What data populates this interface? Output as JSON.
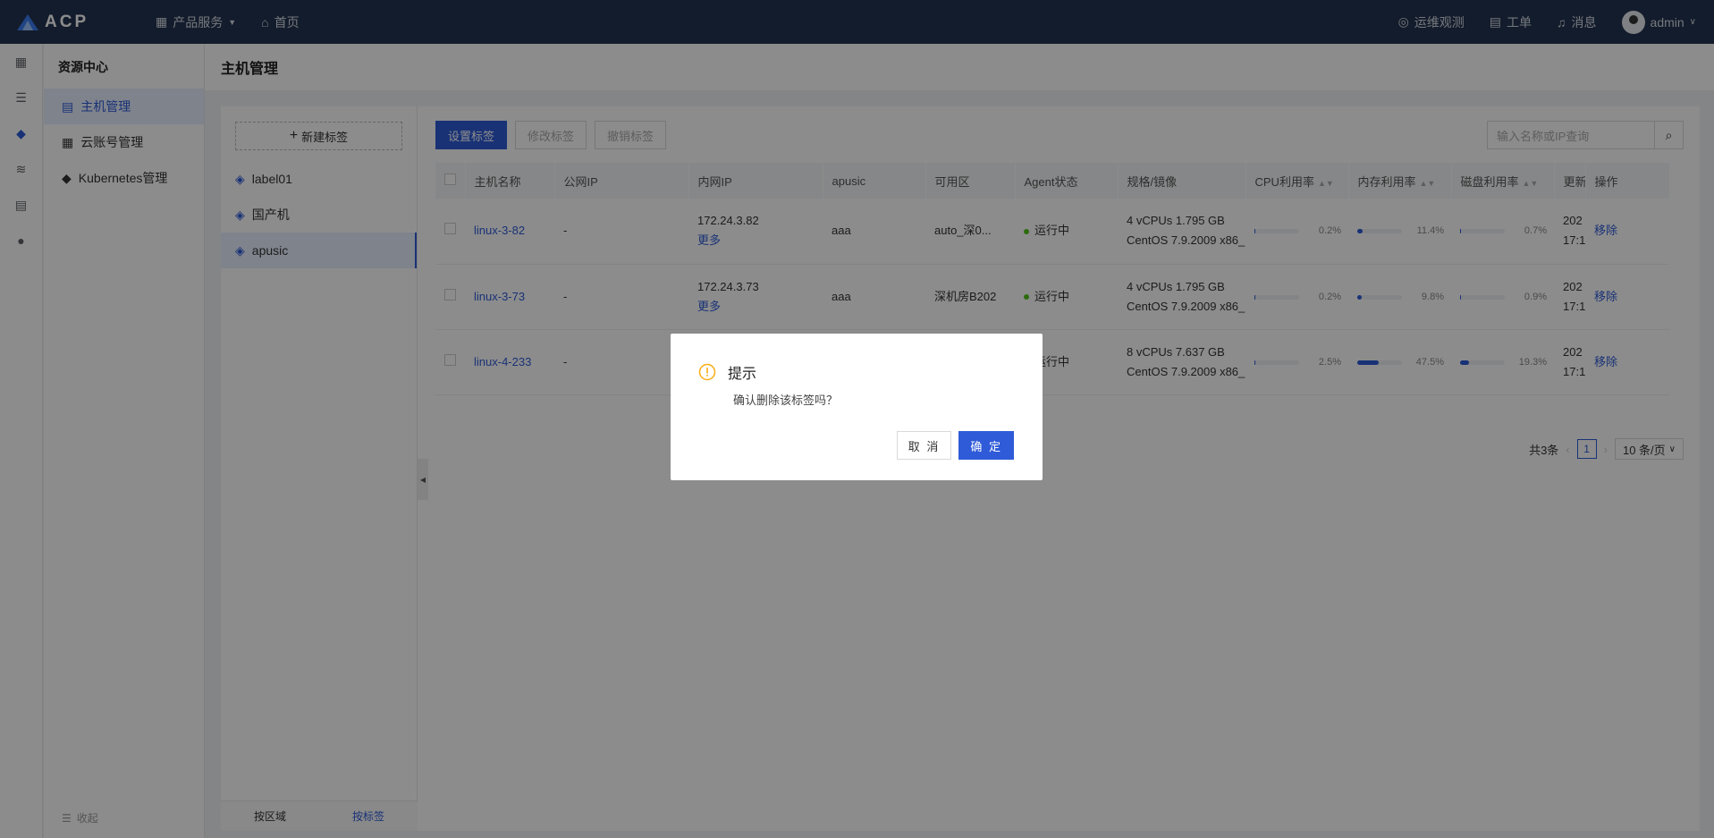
{
  "topbar": {
    "brand": "ACP",
    "nav": [
      {
        "label": "产品服务"
      },
      {
        "label": "首页"
      }
    ],
    "right": [
      {
        "label": "运维观测"
      },
      {
        "label": "工单"
      },
      {
        "label": "消息"
      }
    ],
    "user": "admin"
  },
  "sidebar": {
    "title": "资源中心",
    "items": [
      {
        "label": "主机管理",
        "active": true
      },
      {
        "label": "云账号管理"
      },
      {
        "label": "Kubernetes管理"
      }
    ],
    "collapse": "收起"
  },
  "page": {
    "title": "主机管理"
  },
  "labels": {
    "new_label": "新建标签",
    "items": [
      {
        "label": "label01"
      },
      {
        "label": "国产机"
      },
      {
        "label": "apusic"
      }
    ],
    "tabs": {
      "by_region": "按区域",
      "by_label": "按标签"
    }
  },
  "toolbar": {
    "set_label": "设置标签",
    "edit_label": "修改标签",
    "revoke_label": "撤销标签",
    "search_placeholder": "输入名称或IP查询"
  },
  "table": {
    "headers": [
      "主机名称",
      "公网IP",
      "内网IP",
      "apusic",
      "可用区",
      "Agent状态",
      "规格/镜像",
      "CPU利用率",
      "内存利用率",
      "磁盘利用率",
      "更新",
      "操作"
    ],
    "rows": [
      {
        "name": "linux-3-82",
        "public_ip": "-",
        "private_ip": "172.24.3.82",
        "more": "更多",
        "apusic": "aaa",
        "zone": "auto_深0...",
        "status": "运行中",
        "spec": "4 vCPUs 1.795 GB",
        "image": "CentOS 7.9.2009 x86_",
        "cpu": "0.2%",
        "cpu_v": 0.2,
        "mem": "11.4%",
        "mem_v": 11.4,
        "disk": "0.7%",
        "disk_v": 0.7,
        "upd1": "202",
        "upd2": "17:1",
        "action": "移除"
      },
      {
        "name": "linux-3-73",
        "public_ip": "-",
        "private_ip": "172.24.3.73",
        "more": "更多",
        "apusic": "aaa",
        "zone": "深机房B202",
        "status": "运行中",
        "spec": "4 vCPUs 1.795 GB",
        "image": "CentOS 7.9.2009 x86_",
        "cpu": "0.2%",
        "cpu_v": 0.2,
        "mem": "9.8%",
        "mem_v": 9.8,
        "disk": "0.9%",
        "disk_v": 0.9,
        "upd1": "202",
        "upd2": "17:1",
        "action": "移除"
      },
      {
        "name": "linux-4-233",
        "public_ip": "-",
        "private_ip": "",
        "more": "",
        "apusic": "",
        "zone": "",
        "status": "运行中",
        "spec": "8 vCPUs 7.637 GB",
        "image": "CentOS 7.9.2009 x86_",
        "cpu": "2.5%",
        "cpu_v": 2.5,
        "mem": "47.5%",
        "mem_v": 47.5,
        "disk": "19.3%",
        "disk_v": 19.3,
        "upd1": "202",
        "upd2": "17:1",
        "action": "移除"
      }
    ]
  },
  "pagination": {
    "total": "共3条",
    "page": "1",
    "size": "10 条/页"
  },
  "dialog": {
    "title": "提示",
    "message": "确认删除该标签吗？",
    "cancel": "取 消",
    "ok": "确 定"
  },
  "colors": {
    "primary": "#2f5bd8",
    "topbar": "#243450",
    "warning": "#faad14",
    "success": "#52c41a"
  }
}
